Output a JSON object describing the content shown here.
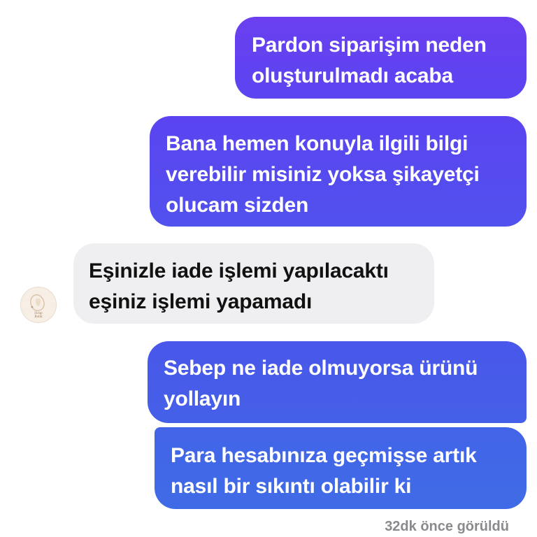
{
  "conversation": {
    "messages": [
      {
        "direction": "outgoing",
        "lines": [
          "Pardon siparişim neden",
          "oluşturulmadı acaba"
        ]
      },
      {
        "direction": "outgoing",
        "lines": [
          "Bana hemen konuyla ilgili bilgi",
          "verebilir misiniz yoksa şikayetçi",
          "olucam sizden"
        ]
      },
      {
        "direction": "incoming",
        "lines": [
          "Eşinizle iade işlemi yapılacaktı",
          "eşiniz işlemi yapamadı"
        ]
      },
      {
        "direction": "outgoing",
        "lines": [
          "Sebep ne iade olmuyorsa ürünü",
          "yollayın"
        ]
      },
      {
        "direction": "outgoing",
        "lines": [
          "Para hesabınıza geçmişse artık",
          "nasıl bir sıkıntı olabilir ki"
        ]
      }
    ],
    "seen_status": "32dk önce görüldü"
  },
  "contact": {
    "avatar_icon": "shop-logo-icon",
    "avatar_text": [
      "Sirap",
      "Butik"
    ]
  },
  "colors": {
    "outgoing_top": "#6a3ff0",
    "outgoing_bottom": "#3f6be6",
    "incoming_bg": "#efeff2",
    "seen_text": "#8a8a8e"
  }
}
